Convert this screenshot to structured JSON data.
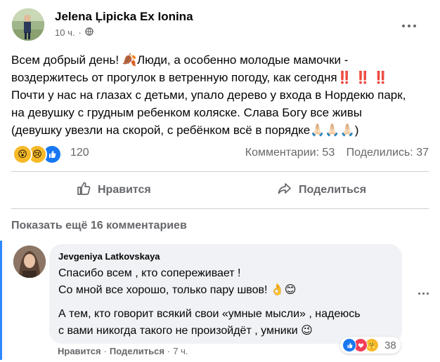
{
  "post": {
    "author": "Jelena Ļipicka Ex Ionina",
    "time": "10 ч.",
    "text_lines": [
      "Всем добрый день! 🍂Люди, а особенно молодые мамочки -",
      "воздержитесь от прогулок в ветренную погоду, как сегодня‼️ ‼️ ‼️",
      "Почти у нас на глазах с детьми, упало дерево у входа в Нордекю парк,",
      "на девушку с грудным ребенком коляске. Слава Богу все живы",
      "(девушку увезли на скорой, с ребёнком всё в порядке🙏🏻🙏🏻🙏🏻)"
    ],
    "reaction_count": "120",
    "comments_label": "Комментарии: 53",
    "shares_label": "Поделились: 37",
    "like_label": "Нравится",
    "share_label": "Поделиться",
    "show_more_comments": "Показать ещё 16 комментариев"
  },
  "comment": {
    "author": "Jevgeniya Latkovskaya",
    "lines_1": [
      "Спасибо всем , кто сопереживает !",
      "Со мной все хорошо, только пару швов! 👌😊"
    ],
    "lines_2": [
      "А тем, кто говорит всякий свои «умные мысли» , надеюсь",
      "с вами никогда такого не произойдёт , умники 😉"
    ],
    "like_label": "Нравится",
    "reply_label": "Поделиться",
    "time": "7 ч.",
    "reaction_count": "38"
  },
  "colors": {
    "accent": "#1877f2",
    "thread_line": "#2d88ff",
    "secondary_text": "#65676b",
    "bubble": "#f0f2f5"
  }
}
